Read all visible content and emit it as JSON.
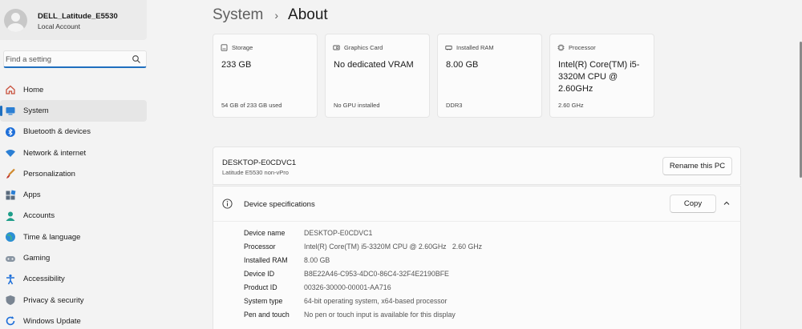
{
  "user": {
    "name": "DELL_Latitude_E5530",
    "account": "Local Account"
  },
  "search": {
    "placeholder": "Find a setting"
  },
  "nav": [
    {
      "label": "Home",
      "icon": "home-icon"
    },
    {
      "label": "System",
      "icon": "system-icon",
      "active": true
    },
    {
      "label": "Bluetooth & devices",
      "icon": "bluetooth-icon"
    },
    {
      "label": "Network & internet",
      "icon": "wifi-icon"
    },
    {
      "label": "Personalization",
      "icon": "brush-icon"
    },
    {
      "label": "Apps",
      "icon": "apps-icon"
    },
    {
      "label": "Accounts",
      "icon": "accounts-icon"
    },
    {
      "label": "Time & language",
      "icon": "globe-icon"
    },
    {
      "label": "Gaming",
      "icon": "gamepad-icon"
    },
    {
      "label": "Accessibility",
      "icon": "accessibility-icon"
    },
    {
      "label": "Privacy & security",
      "icon": "shield-icon"
    },
    {
      "label": "Windows Update",
      "icon": "update-icon"
    }
  ],
  "breadcrumb": {
    "parent": "System",
    "separator": "›",
    "current": "About"
  },
  "cards": [
    {
      "title": "Storage",
      "value": "233 GB",
      "foot": "54 GB of 233 GB used",
      "icon": "storage-icon"
    },
    {
      "title": "Graphics Card",
      "value": "No dedicated VRAM",
      "foot": "No GPU installed",
      "icon": "graphics-card-icon"
    },
    {
      "title": "Installed RAM",
      "value": "8.00 GB",
      "foot": "DDR3",
      "icon": "ram-icon"
    },
    {
      "title": "Processor",
      "value": "Intel(R) Core(TM) i5-3320M CPU @ 2.60GHz",
      "foot": "2.60 GHz",
      "icon": "processor-icon"
    }
  ],
  "pc": {
    "name": "DESKTOP-E0CDVC1",
    "model": "Latitude E5530 non-vPro",
    "rename_label": "Rename this PC"
  },
  "specs": {
    "title": "Device specifications",
    "copy_label": "Copy",
    "rows": [
      {
        "key": "Device name",
        "value": "DESKTOP-E0CDVC1"
      },
      {
        "key": "Processor",
        "value": "Intel(R) Core(TM) i5-3320M CPU @ 2.60GHz   2.60 GHz"
      },
      {
        "key": "Installed RAM",
        "value": "8.00 GB"
      },
      {
        "key": "Device ID",
        "value": "B8E22A46-C953-4DC0-86C4-32F4E2190BFE"
      },
      {
        "key": "Product ID",
        "value": "00326-30000-00001-AA716"
      },
      {
        "key": "System type",
        "value": "64-bit operating system, x64-based processor"
      },
      {
        "key": "Pen and touch",
        "value": "No pen or touch input is available for this display"
      }
    ]
  },
  "colors": {
    "accent": "#1f6fbf",
    "background": "#f3f3f3",
    "card": "#fbfbfb"
  }
}
